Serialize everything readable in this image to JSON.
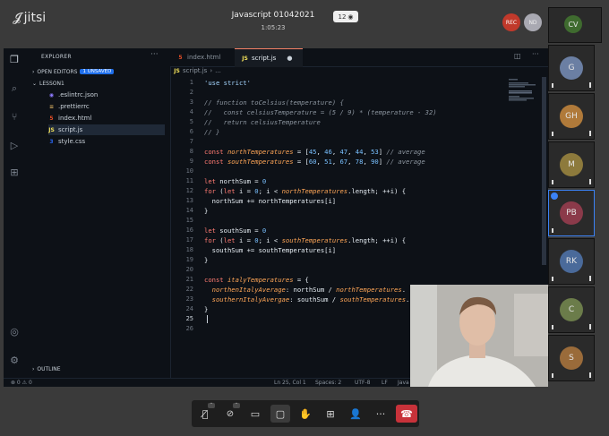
{
  "header": {
    "app_name": "jitsi",
    "meeting_title": "Javascript 01042021",
    "meeting_time": "1:05:23",
    "participant_count": "12",
    "rec_label": "REC",
    "nd_label": "ND"
  },
  "sidebar": {
    "title": "EXPLORER",
    "open_editors": "OPEN EDITORS",
    "unsaved_badge": "1 UNSAVED",
    "folder": "LESSON1",
    "files": [
      ".eslintrc.json",
      ".prettierrc",
      "index.html",
      "script.js",
      "style.css"
    ],
    "outline": "OUTLINE"
  },
  "tabs": [
    "index.html",
    "script.js"
  ],
  "breadcrumb": [
    "script.js",
    "..."
  ],
  "editor": {
    "line_numbers": [
      "1",
      "2",
      "3",
      "4",
      "5",
      "6",
      "7",
      "8",
      "9",
      "10",
      "11",
      "12",
      "13",
      "14",
      "15",
      "16",
      "17",
      "18",
      "19",
      "20",
      "21",
      "22",
      "23",
      "24",
      "25",
      "26"
    ]
  },
  "statusbar": {
    "problems": "⊗ 0 ⚠ 0",
    "position": "Ln 25, Col 1",
    "spaces": "Spaces: 2",
    "encoding": "UTF-8",
    "eol": "LF",
    "language": "Java"
  },
  "filmstrip": [
    {
      "initials": "CV",
      "color": "#3f6b2f"
    },
    {
      "initials": "G",
      "color": "#6b7fa3"
    },
    {
      "initials": "GH",
      "color": "#b07a3a"
    },
    {
      "initials": "M",
      "color": "#8d7a3c"
    },
    {
      "initials": "PB",
      "color": "#8b3a4a"
    },
    {
      "initials": "RK",
      "color": "#4a6a9a"
    },
    {
      "initials": "C",
      "color": "#6b7c4a"
    },
    {
      "initials": "S",
      "color": "#9a6b3a"
    }
  ]
}
